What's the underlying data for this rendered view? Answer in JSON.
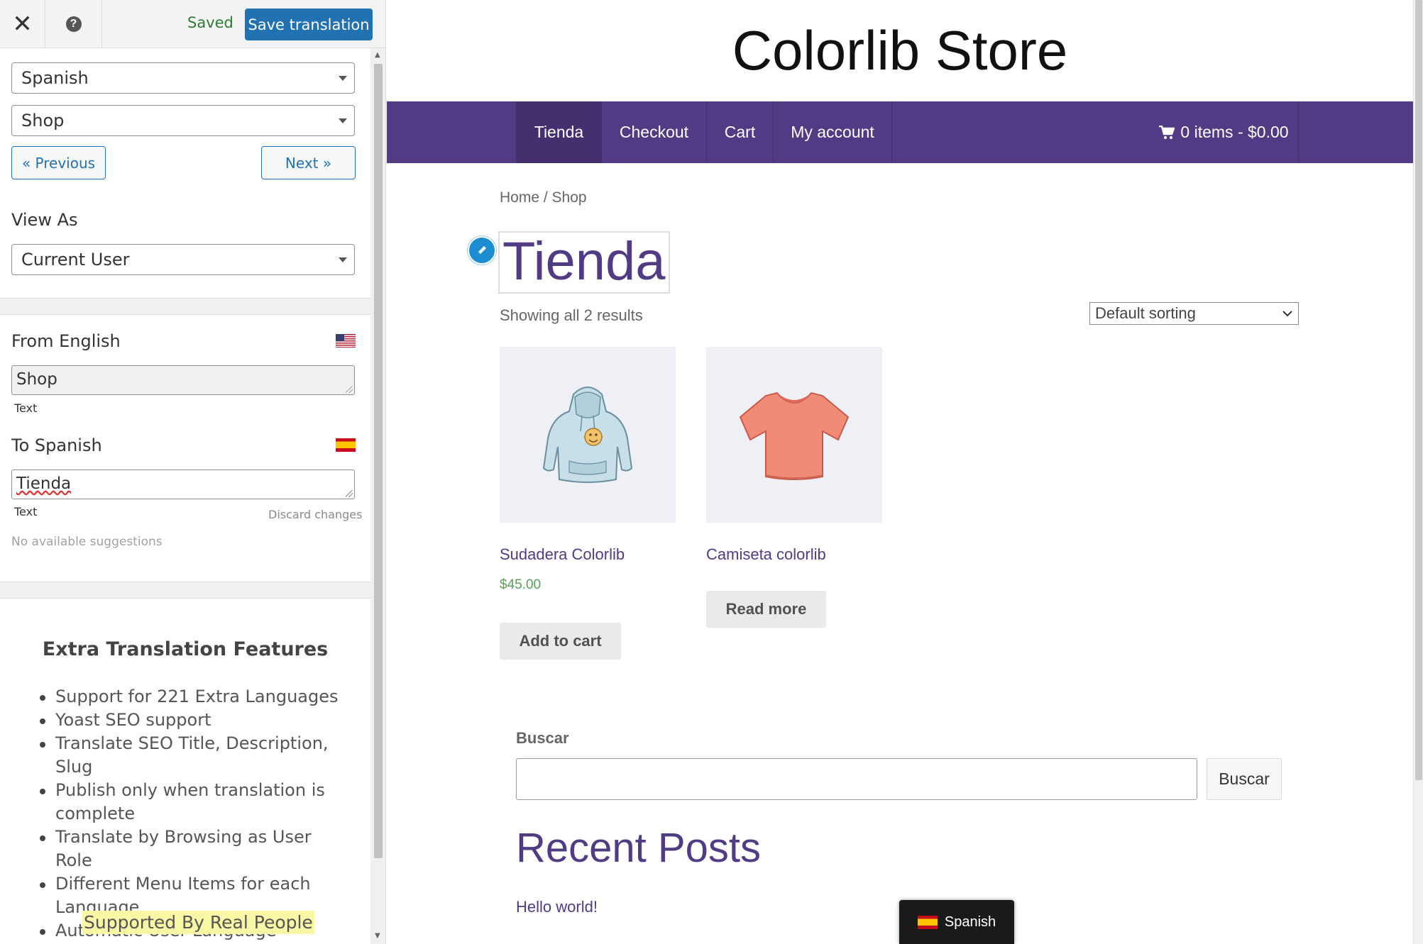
{
  "panel": {
    "close_icon": "close-icon",
    "help_icon": "help-icon",
    "help_glyph": "?",
    "saved_label": "Saved",
    "save_button": "Save translation",
    "language_select": "Spanish",
    "page_select": "Shop",
    "previous_button": "« Previous",
    "next_button": "Next »",
    "view_as_label": "View As",
    "view_as_select": "Current User",
    "from_label": "From English",
    "from_value": "Shop",
    "from_type": "Text",
    "to_label": "To Spanish",
    "to_value": "Tienda",
    "to_type": "Text",
    "discard_label": "Discard changes",
    "no_suggestions": "No available suggestions",
    "extra_title": "Extra Translation Features",
    "features": [
      "Support for 221 Extra Languages",
      "Yoast SEO support",
      "Translate SEO Title, Description, Slug",
      "Publish only when translation is complete",
      "Translate by Browsing as User Role",
      "Different Menu Items for each Language",
      "Automatic User Language Detection"
    ],
    "support_note": "Supported By Real People"
  },
  "site": {
    "title": "Colorlib Store",
    "nav": [
      "Tienda",
      "Checkout",
      "Cart",
      "My account"
    ],
    "cart_summary": "0 items - $0.00",
    "breadcrumb_home": "Home",
    "breadcrumb_sep": " / ",
    "breadcrumb_current": "Shop",
    "heading": "Tienda",
    "result_count": "Showing all 2 results",
    "sort_selected": "Default sorting",
    "products": [
      {
        "name": "Sudadera Colorlib",
        "price": "$45.00",
        "button": "Add to cart"
      },
      {
        "name": "Camiseta colorlib",
        "price": "",
        "button": "Read more"
      }
    ],
    "search_label": "Buscar",
    "search_button": "Buscar",
    "recent_posts_title": "Recent Posts",
    "recent_post": "Hello world!",
    "language_switcher": "Spanish"
  },
  "colors": {
    "nav_purple": "#513b84",
    "save_blue": "#2271b1",
    "price_green": "#58a05a",
    "saved_green": "#2e7d32"
  }
}
